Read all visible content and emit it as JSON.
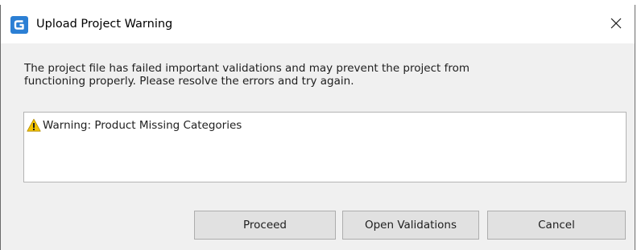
{
  "window": {
    "title": "Upload Project Warning",
    "app_icon": "app-logo-icon",
    "close_icon": "close-icon",
    "accent_color": "#2b7fd4"
  },
  "message": {
    "line1": "The project file has failed important validations and may prevent the project from",
    "line2": "functioning properly. Please resolve the errors and try again."
  },
  "warnings": [
    {
      "icon": "warning-triangle-icon",
      "text": "Warning: Product Missing Categories",
      "color": "#f2c300"
    }
  ],
  "buttons": {
    "proceed": "Proceed",
    "open_validations": "Open Validations",
    "cancel": "Cancel"
  }
}
